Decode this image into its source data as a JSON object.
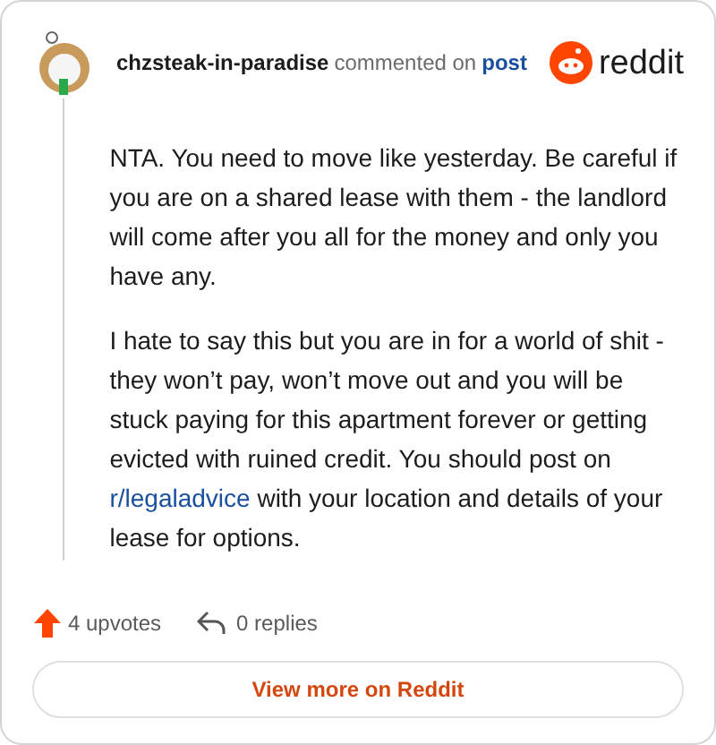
{
  "header": {
    "username": "chzsteak-in-paradise",
    "action": "commented on",
    "post_link": "post",
    "brand": "reddit"
  },
  "paragraphs": [
    {
      "text": "NTA. You need to move like yesterday. Be careful if you are on a shared lease with them - the landlord will come after you all for the money and only you have any."
    },
    {
      "text": "I hate to say this but you are in for a world of shit - they won’t pay, won’t move out and you will be stuck paying for this apartment forever or getting evicted with ruined credit. You should post on",
      "link": "r/legaladvice",
      "text_after": "with your location and details of your lease for options."
    }
  ],
  "stats": {
    "upvotes": "4 upvotes",
    "replies": "0 replies"
  },
  "button": "View more on Reddit"
}
